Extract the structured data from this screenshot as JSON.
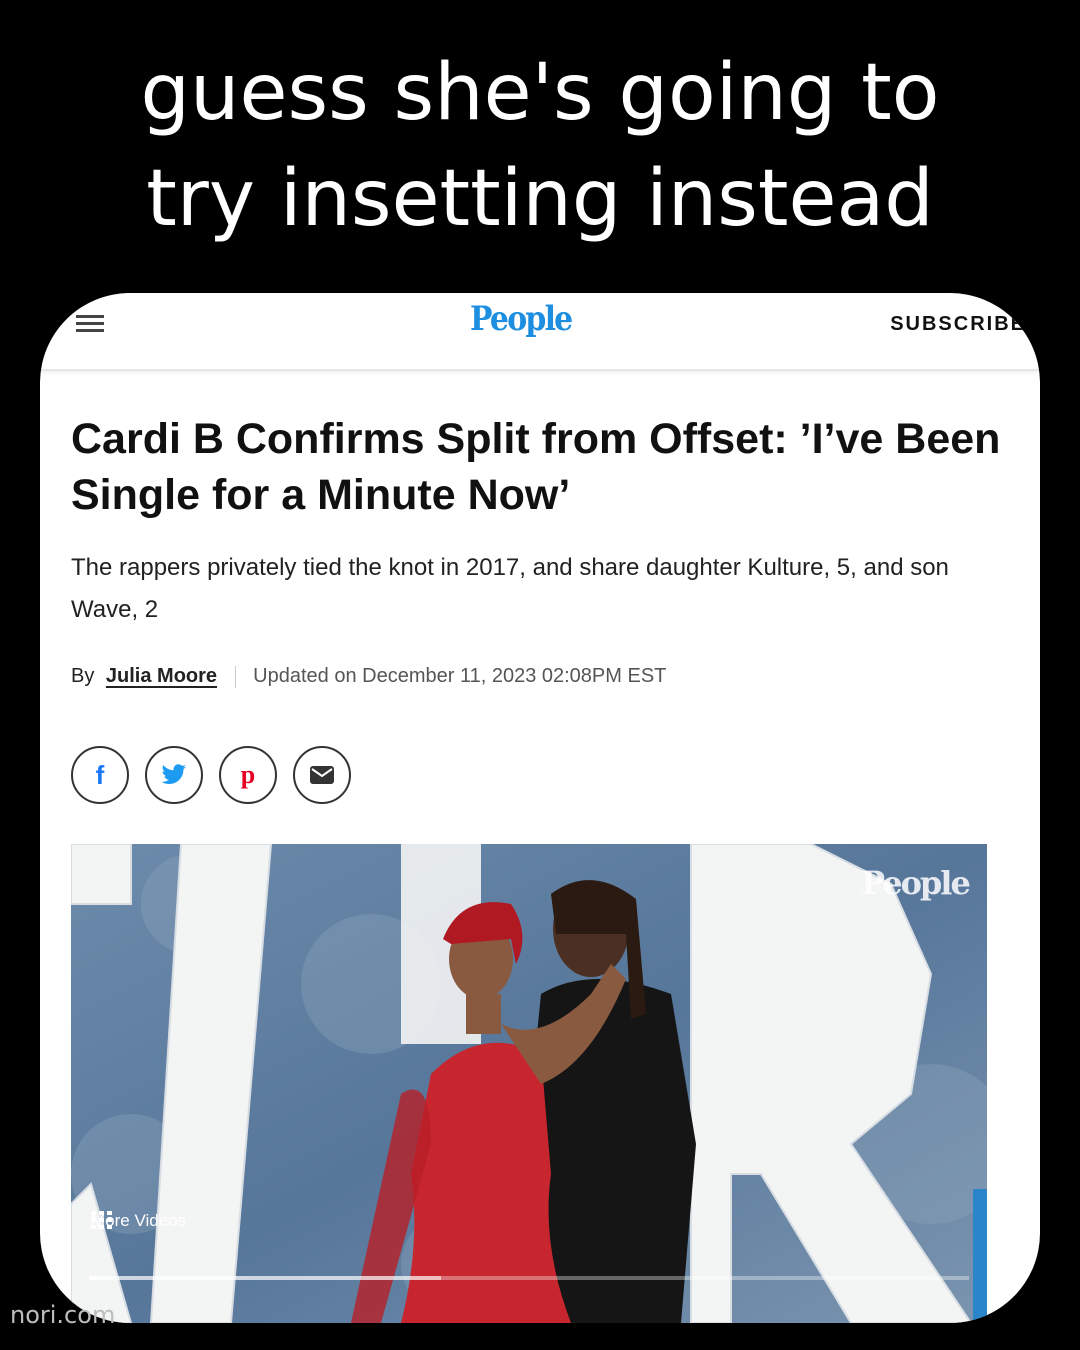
{
  "caption": {
    "line1": "guess she's going to",
    "line2": "try insetting instead"
  },
  "site": {
    "logo": "People",
    "subscribe_label": "SUBSCRIBE"
  },
  "article": {
    "headline": "Cardi B Confirms Split from Offset: ’I’ve Been Single for a Minute Now’",
    "dek": "The rappers privately tied the knot in 2017, and share daughter Kulture, 5, and son Wave, 2",
    "by_label": "By",
    "author": "Julia Moore",
    "updated": "Updated on December 11, 2023 02:08PM EST"
  },
  "share": {
    "icons": [
      "facebook-icon",
      "twitter-icon",
      "pinterest-icon",
      "email-icon"
    ]
  },
  "video": {
    "watermark": "People",
    "more_videos_label": "More Videos",
    "progress": 0.01,
    "buffered": 0.4
  },
  "footer": {
    "watermark": "nori.com"
  },
  "colors": {
    "brand_blue": "#1e8fe0",
    "dress_red": "#c8262e",
    "backdrop": "#5f7fa0"
  }
}
